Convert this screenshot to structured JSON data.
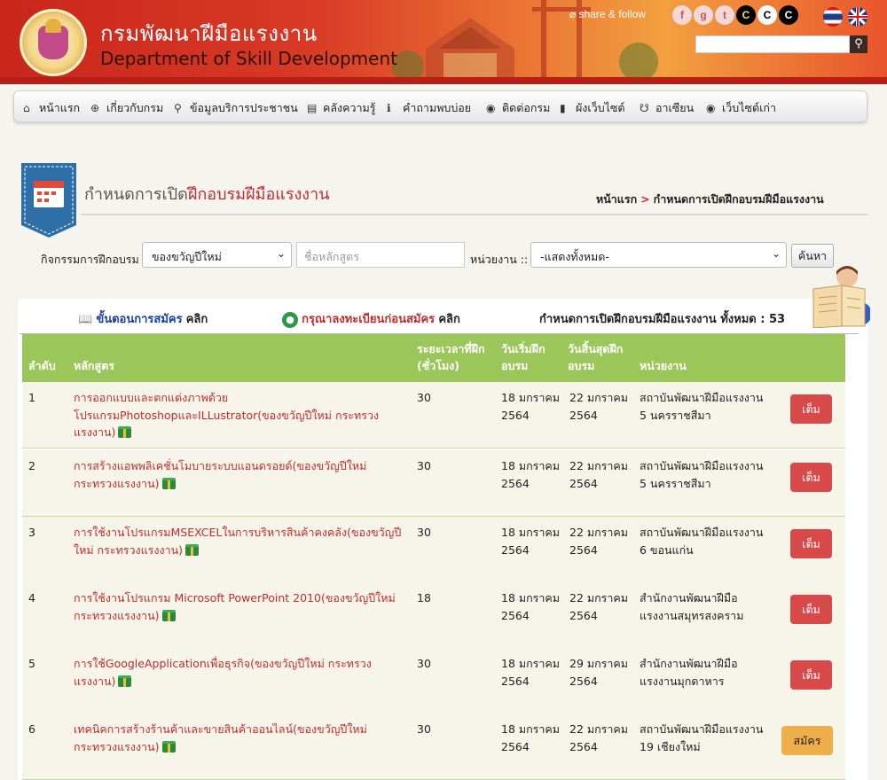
{
  "header": {
    "title_th": "กรมพัฒนาฝีมือแรงงาน",
    "title_en": "Department of Skill Development",
    "share_label": "share & follow",
    "social": [
      {
        "name": "facebook",
        "glyph": "f",
        "bg": "#f2d8d8",
        "fg": "#c8584a"
      },
      {
        "name": "gplus",
        "glyph": "g",
        "bg": "#f2d8d8",
        "fg": "#c8584a"
      },
      {
        "name": "twitter",
        "glyph": "t",
        "bg": "#f2d8d8",
        "fg": "#c8584a"
      },
      {
        "name": "contrast-yellow",
        "glyph": "C",
        "bg": "#000000",
        "fg": "#f3e23a"
      },
      {
        "name": "contrast-white",
        "glyph": "C",
        "bg": "#ffffff",
        "fg": "#000000"
      },
      {
        "name": "contrast-black",
        "glyph": "C",
        "bg": "#000000",
        "fg": "#ffffff"
      }
    ],
    "search_placeholder": ""
  },
  "nav": [
    {
      "label": "หน้าแรก",
      "icon": "home-icon",
      "glyph": "⌂"
    },
    {
      "label": "เกี่ยวกับกรม",
      "icon": "plus-circle-icon",
      "glyph": "⊕"
    },
    {
      "label": "ข้อมูลบริการประชาชน",
      "icon": "search-icon",
      "glyph": "⚲"
    },
    {
      "label": "คลังความรู้",
      "icon": "book-icon",
      "glyph": "▤"
    },
    {
      "label": "คำถามพบบ่อย",
      "icon": "info-icon",
      "glyph": "ℹ"
    },
    {
      "label": "ติดต่อกรม",
      "icon": "map-pin-icon",
      "glyph": "◉"
    },
    {
      "label": "ผังเว็บไซต์",
      "icon": "mobile-icon",
      "glyph": "▮"
    },
    {
      "label": "อาเซียน",
      "icon": "handshake-icon",
      "glyph": "☋"
    },
    {
      "label": "เว็บไซต์เก่า",
      "icon": "map-pin-icon",
      "glyph": "◉"
    }
  ],
  "page": {
    "title_prefix": "กำหนดการเปิด",
    "title_highlight": "ฝึกอบรมฝีมือแรงงาน",
    "breadcrumb_home": "หน้าแรก",
    "breadcrumb_sep": ">",
    "breadcrumb_current": "กำหนดการเปิดฝึกอบรมฝีมือแรงงาน"
  },
  "filter": {
    "activity_label": "กิจกรรมการฝึกอบรม",
    "activity_value": "ของขวัญปีใหม่",
    "course_placeholder": "ชื่อหลักสูตร",
    "unit_label": "หน่วยงาน ::",
    "unit_value": "-แสดงทั้งหมด-",
    "search_button": "ค้นหา"
  },
  "info": {
    "steps_link": "ขั้นตอนการสมัคร",
    "steps_click": "คลิก",
    "register_link": "กรุณาลงทะเบียนก่อนสมัคร",
    "register_click": "คลิก",
    "total_text": "กำหนดการเปิดฝึกอบรมฝีมือแรงงาน ทั้งหมด : 53"
  },
  "table": {
    "headers": {
      "no": "ลำดับ",
      "course": "หลักสูตร",
      "hours": "ระยะเวลาที่ฝึก (ชั่วโมง)",
      "start": "วันเริ่มฝึกอบรม",
      "end": "วันสิ้นสุดฝึกอบรม",
      "unit": "หน่วยงาน"
    },
    "rows": [
      {
        "no": "1",
        "course": "การออกแบบและตกแต่งภาพด้วยโปรแกรมPhotoshopและILLustrator(ของขวัญปีใหม่ กระทรวงแรงงาน)",
        "hours": "30",
        "start": "18 มกราคม 2564",
        "end": "22 มกราคม 2564",
        "unit": "สถาบันพัฒนาฝีมือแรงงาน 5 นครราชสีมา",
        "action": "เต็ม",
        "status": "full"
      },
      {
        "no": "2",
        "course": "การสร้างแอพพลิเคชั่นโมบายระบบแอนดรอยด์(ของขวัญปีใหม่ กระทรวงแรงงาน)",
        "hours": "30",
        "start": "18 มกราคม 2564",
        "end": "22 มกราคม 2564",
        "unit": "สถาบันพัฒนาฝีมือแรงงาน 5 นครราชสีมา",
        "action": "เต็ม",
        "status": "full"
      },
      {
        "no": "3",
        "course": "การใช้งานโปรแกรมMSEXCELในการบริหารสินค้าคงคลัง(ของขวัญปีใหม่ กระทรวงแรงงาน)",
        "hours": "30",
        "start": "18 มกราคม 2564",
        "end": "22 มกราคม 2564",
        "unit": "สถาบันพัฒนาฝีมือแรงงาน 6 ขอนแก่น",
        "action": "เต็ม",
        "status": "full"
      },
      {
        "no": "4",
        "course": "การใช้งานโปรแกรม Microsoft PowerPoint 2010(ของขวัญปีใหม่ กระทรวงแรงงาน)",
        "hours": "18",
        "start": "18 มกราคม 2564",
        "end": "22 มกราคม 2564",
        "unit": "สำนักงานพัฒนาฝีมือแรงงานสมุทรสงคราม",
        "action": "เต็ม",
        "status": "full"
      },
      {
        "no": "5",
        "course": "การใช้GoogleApplicationเพื่อธุรกิจ(ของขวัญปีใหม่ กระทรวงแรงงาน)",
        "hours": "30",
        "start": "18 มกราคม 2564",
        "end": "29 มกราคม 2564",
        "unit": "สำนักงานพัฒนาฝีมือแรงงานมุกดาหาร",
        "action": "เต็ม",
        "status": "full"
      },
      {
        "no": "6",
        "course": "เทคนิคการสร้างร้านค้าและขายสินค้าออนไลน์(ของขวัญปีใหม่ กระทรวงแรงงาน)",
        "hours": "30",
        "start": "18 มกราคม 2564",
        "end": "22 มกราคม 2564",
        "unit": "สถาบันพัฒนาฝีมือแรงงาน 19 เชียงใหม่",
        "action": "สมัคร",
        "status": "open"
      }
    ]
  }
}
